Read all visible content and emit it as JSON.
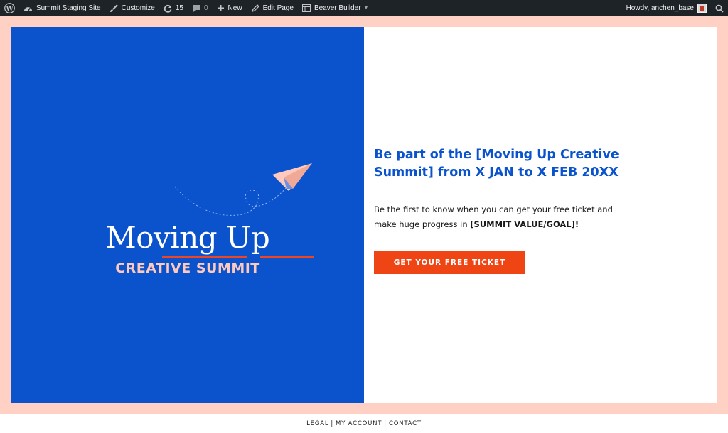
{
  "admin_bar": {
    "site_name": "Summit Staging Site",
    "customize": "Customize",
    "updates_count": "15",
    "comments_count": "0",
    "new_label": "New",
    "edit_page": "Edit Page",
    "beaver_builder": "Beaver Builder",
    "greeting": "Howdy, anchen_base"
  },
  "hero": {
    "logo_title": "Moving Up",
    "logo_subtitle": "CREATIVE SUMMIT",
    "headline": "Be part of the [Moving Up Creative Summit] from X JAN to X FEB 20XX",
    "body_prefix": "Be the first to know when you can get your free ticket and make huge progress in ",
    "body_bold": "[SUMMIT VALUE/GOAL]",
    "body_suffix": "!",
    "cta_label": "GET YOUR FREE TICKET"
  },
  "footer": {
    "links": [
      "LEGAL",
      "MY ACCOUNT",
      "CONTACT"
    ],
    "separator": "|"
  },
  "colors": {
    "admin_bar_bg": "#1d2327",
    "frame_bg": "#ffd1c4",
    "brand_blue": "#0a53cd",
    "accent_orange": "#ef4414",
    "logo_pink": "#ffc9bd"
  }
}
